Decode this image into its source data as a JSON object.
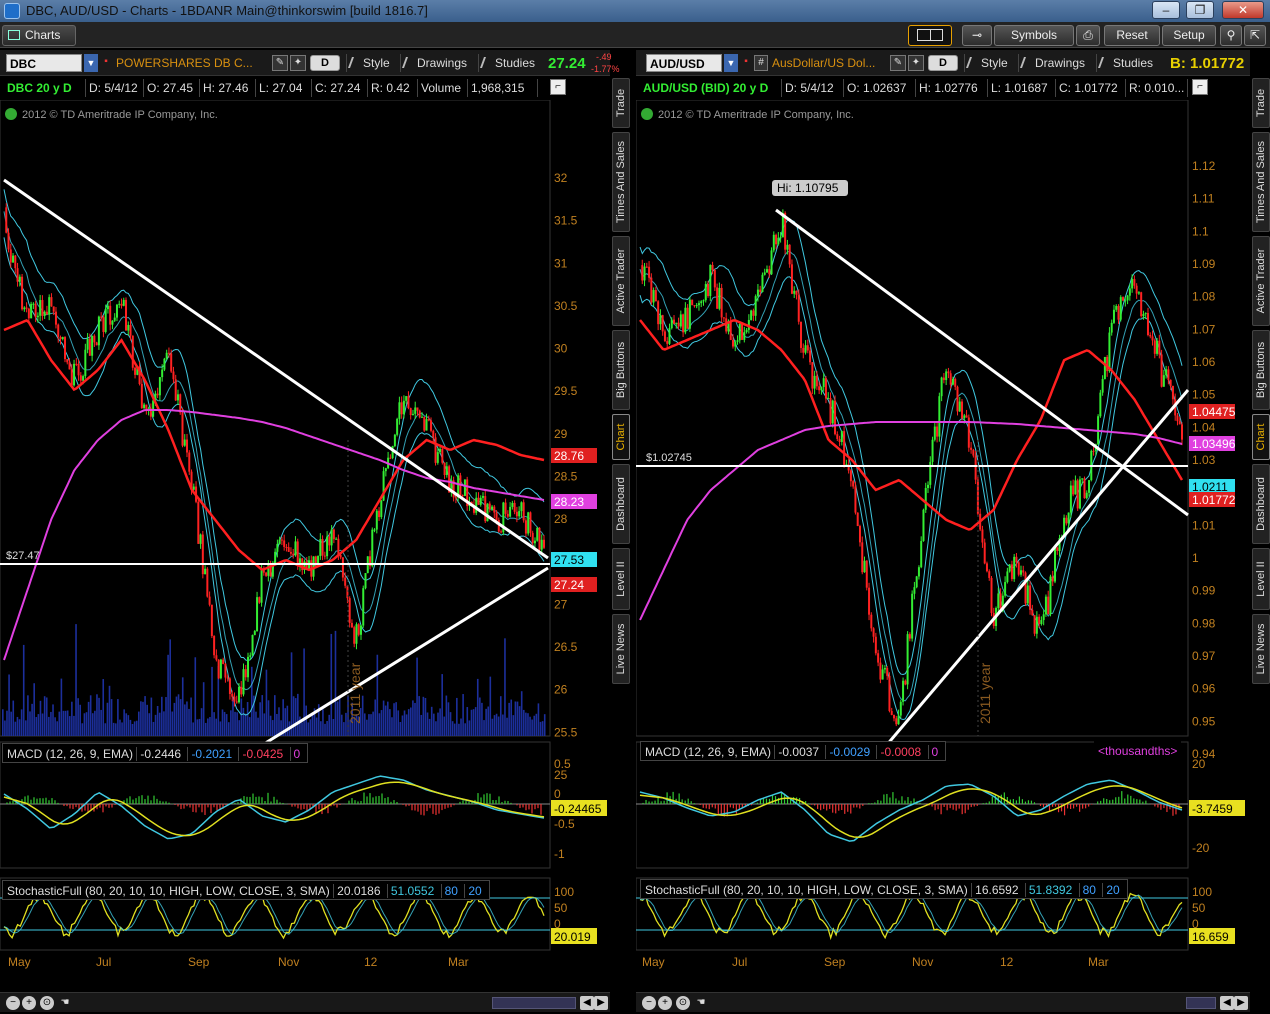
{
  "window": {
    "title": "DBC, AUD/USD - Charts - 1BDANR Main@thinkorswim [build 1816.7]"
  },
  "toolbar": {
    "charts_tab": "Charts",
    "symbols_label": "Symbols",
    "reset_label": "Reset",
    "setup_label": "Setup"
  },
  "left": {
    "symbol": "DBC",
    "description": "POWERSHARES DB C...",
    "period": "D",
    "price": "27.24",
    "change_net": "-.49",
    "change_pct": "-1.77%",
    "menu": {
      "style": "Style",
      "drawings": "Drawings",
      "studies": "Studies"
    },
    "info": {
      "sym": "DBC 20 y D",
      "date": "D: 5/4/12",
      "open": "O: 27.45",
      "high": "H: 27.46",
      "low": "L: 27.04",
      "close": "C: 27.24",
      "range": "R: 0.42",
      "volume_label": "Volume",
      "volume": "1,968,315"
    },
    "copyright": "2012 © TD Ameritrade IP Company, Inc.",
    "hline_label": "$27.47",
    "year_marker": "2011 year",
    "price_axis": [
      "32",
      "31.5",
      "31",
      "30.5",
      "30",
      "29.5",
      "29",
      "28.5",
      "28",
      "27.5",
      "27",
      "26.5",
      "26",
      "25.5",
      "25"
    ],
    "price_tags": [
      {
        "text": "28.76",
        "bg": "#e02020",
        "fg": "#ffffff"
      },
      {
        "text": "28.23",
        "bg": "#e040e0",
        "fg": "#ffffff"
      },
      {
        "text": "27.53",
        "bg": "#30e0f0",
        "fg": "#000000"
      },
      {
        "text": "27.24",
        "bg": "#e02020",
        "fg": "#ffffff"
      }
    ],
    "macd": {
      "label": "MACD (12, 26, 9, EMA)",
      "v1": "-0.2446",
      "v2": "-0.2021",
      "v3": "-0.0425",
      "v4": "0",
      "axis": [
        "0.5",
        "0",
        "-0.5",
        "-1"
      ],
      "tag": "-0.24465"
    },
    "stoch": {
      "label": "StochasticFull (80, 20, 10, 10, HIGH, LOW, CLOSE, 3, SMA)",
      "v1": "20.0186",
      "v2": "51.0552",
      "v3": "80",
      "v4": "20",
      "axis": [
        "100",
        "50",
        "0"
      ],
      "tag": "20.019"
    },
    "time_axis": [
      "May",
      "Jul",
      "Sep",
      "Nov",
      "12",
      "Mar"
    ]
  },
  "right": {
    "symbol": "AUD/USD",
    "description": "AusDollar/US Dol...",
    "period": "D",
    "bid_label": "B: 1.01772",
    "menu": {
      "style": "Style",
      "drawings": "Drawings",
      "studies": "Studies"
    },
    "info": {
      "sym": "AUD/USD (BID) 20 y D",
      "date": "D: 5/4/12",
      "open": "O: 1.02637",
      "high": "H: 1.02776",
      "low": "L: 1.01687",
      "close": "C: 1.01772",
      "range": "R: 0.010..."
    },
    "copyright": "2012 © TD Ameritrade IP Company, Inc.",
    "hi_label": "Hi: 1.10795",
    "hline_label": "$1.02745",
    "year_marker": "2011 year",
    "price_axis": [
      "1.12",
      "1.11",
      "1.1",
      "1.09",
      "1.08",
      "1.07",
      "1.06",
      "1.05",
      "1.04",
      "1.03",
      "1.02",
      "1.01",
      "1",
      "0.99",
      "0.98",
      "0.97",
      "0.96",
      "0.95",
      "0.94"
    ],
    "price_tags": [
      {
        "text": "1.04475",
        "bg": "#e02020",
        "fg": "#ffffff"
      },
      {
        "text": "1.03496",
        "bg": "#e040e0",
        "fg": "#ffffff"
      },
      {
        "text": "1.0211",
        "bg": "#30e0f0",
        "fg": "#000000"
      },
      {
        "text": "1.01772",
        "bg": "#e02020",
        "fg": "#ffffff"
      }
    ],
    "macd": {
      "label": "MACD (12, 26, 9, EMA)",
      "v1": "-0.0037",
      "v2": "-0.0029",
      "v3": "-0.0008",
      "v4": "0",
      "units": "<thousandths>",
      "axis": [
        "20",
        "0",
        "-20"
      ],
      "tag": "-3.7459"
    },
    "stoch": {
      "label": "StochasticFull (80, 20, 10, 10, HIGH, LOW, CLOSE, 3, SMA)",
      "v1": "16.6592",
      "v2": "51.8392",
      "v3": "80",
      "v4": "20",
      "axis": [
        "100",
        "50",
        "0"
      ],
      "tag": "16.659"
    },
    "time_axis": [
      "May",
      "Jul",
      "Sep",
      "Nov",
      "12",
      "Mar"
    ]
  },
  "side_tabs": [
    "Trade",
    "Times And Sales",
    "Active Trader",
    "Big Buttons",
    "Chart",
    "Dashboard",
    "Level II",
    "Live News"
  ],
  "colors": {
    "up": "#33ee33",
    "down": "#ff2222",
    "ma_red": "#ff2020",
    "ma_magenta": "#e040e0",
    "bollinger": "#40c8e0",
    "volume": "#1c2f9c",
    "stoch_k": "#e0e020",
    "macd_signal": "#e0e020"
  }
}
